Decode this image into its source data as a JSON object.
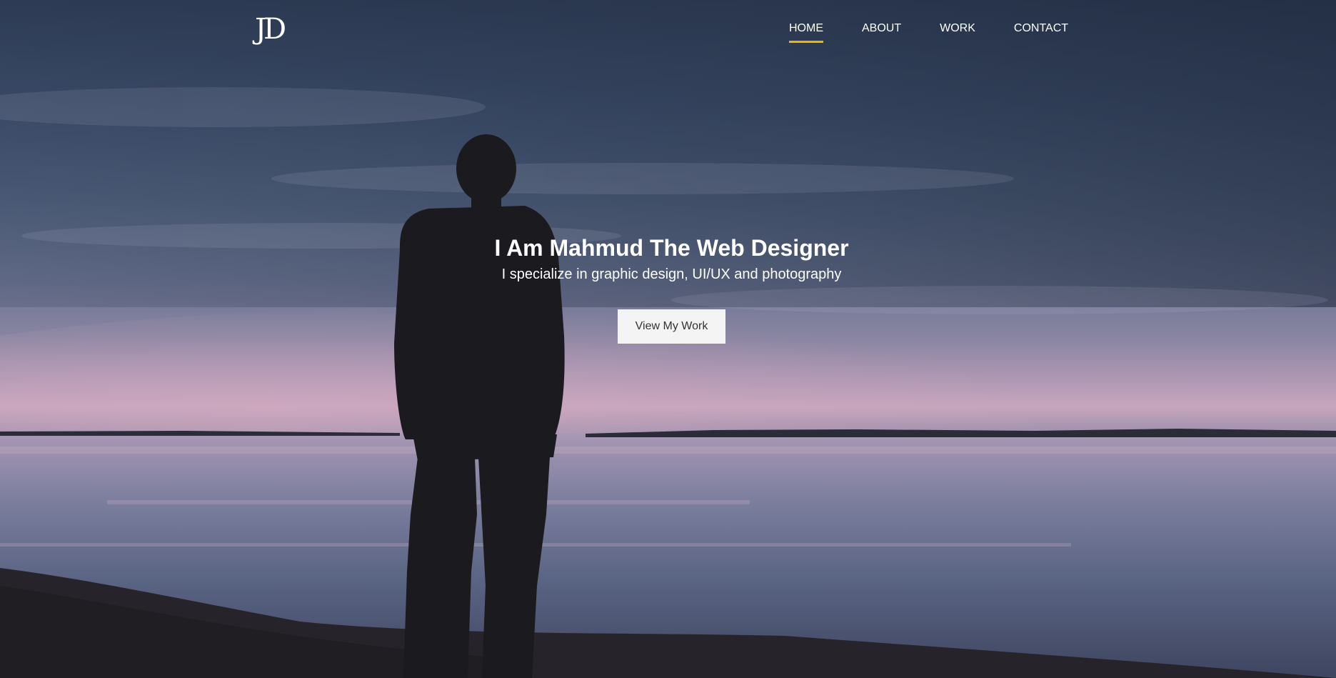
{
  "brand": {
    "logo_text": "JD"
  },
  "nav": {
    "items": [
      {
        "label": "HOME",
        "active": true
      },
      {
        "label": "ABOUT",
        "active": false
      },
      {
        "label": "WORK",
        "active": false
      },
      {
        "label": "CONTACT",
        "active": false
      }
    ]
  },
  "hero": {
    "title": "I Am Mahmud The Web Designer",
    "subtitle": "I specialize in graphic design, UI/UX and photography",
    "cta_label": "View My Work"
  },
  "colors": {
    "nav_active_underline": "#f0b400",
    "text": "#ffffff",
    "button_bg": "#f4f4f4",
    "button_text": "#333333"
  }
}
